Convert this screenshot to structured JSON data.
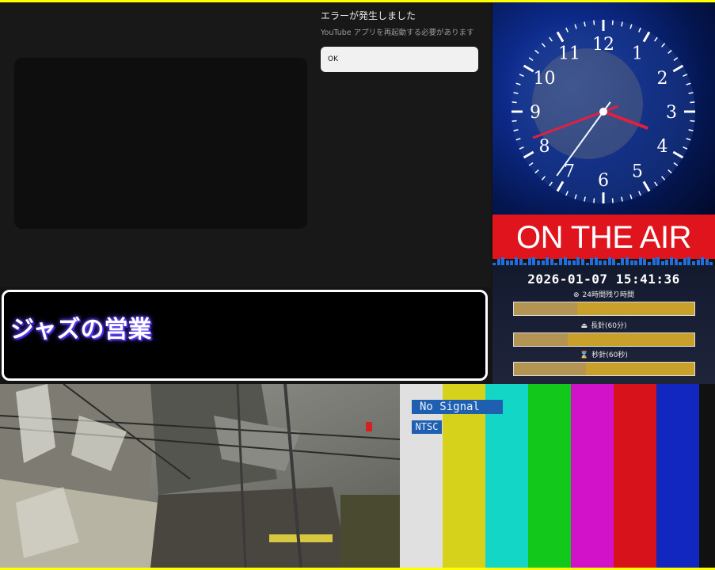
{
  "youtube_error": {
    "title": "エラーが発生しました",
    "message": "YouTube アプリを再起動する必要があります",
    "ok_label": "OK"
  },
  "clock": {
    "numerals": [
      "12",
      "1",
      "2",
      "3",
      "4",
      "5",
      "6",
      "7",
      "8",
      "9",
      "10",
      "11"
    ],
    "time": {
      "hour": 15,
      "minute": 41,
      "second": 36
    }
  },
  "on_air": {
    "label": "ON THE AIR",
    "accent_color": "#e0141c"
  },
  "timer": {
    "datetime": "2026-01-07 15:41:36",
    "day_label": "24時間残り時間",
    "day_icon": "clock-icon",
    "minute_label": "長針(60分)",
    "minute_icon": "bell-icon",
    "second_label": "秒針(60秒)",
    "second_icon": "hourglass-icon",
    "day_progress": 0.35,
    "minute_progress": 0.3,
    "second_progress": 0.4
  },
  "caption": {
    "text": "ジャズの営業"
  },
  "camera": {
    "description_icon": "street-camera-feed"
  },
  "color_bars": {
    "no_signal": "No Signal",
    "standard": "NTSC",
    "bar_colors": [
      "#e0e0e0",
      "#d6d11a",
      "#14d6c6",
      "#12c81a",
      "#d212c8",
      "#d8121a",
      "#1226c0",
      "#111111"
    ]
  }
}
